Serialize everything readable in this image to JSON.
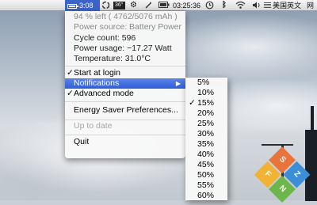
{
  "menubar": {
    "battery_time": "3:08",
    "clock": "03:25:36",
    "input_method": "美国英文",
    "misc_text": "网",
    "cpu_badge": "36°"
  },
  "menu": {
    "info": [
      "94 % left ( 4762/5076 mAh )",
      "Power source: Battery Power",
      "Cycle count: 596",
      "Power usage: −17.27 Watt",
      "Temperature: 31.0°C"
    ],
    "start_at_login": "Start at login",
    "notifications": "Notifications",
    "advanced_mode": "Advanced mode",
    "energy_saver": "Energy Saver Preferences...",
    "up_to_date": "Up to date",
    "quit": "Quit",
    "checkmark": "✓",
    "arrow": "▶"
  },
  "submenu": {
    "items": [
      "5%",
      "10%",
      "15%",
      "20%",
      "25%",
      "30%",
      "35%",
      "40%",
      "45%",
      "50%",
      "55%",
      "60%"
    ],
    "selected": "15%"
  },
  "logo": {
    "letters": [
      "S",
      "Z",
      "F",
      "N"
    ],
    "colors": [
      "#e8743b",
      "#3c8fd6",
      "#f2b234",
      "#6cb64a"
    ]
  }
}
